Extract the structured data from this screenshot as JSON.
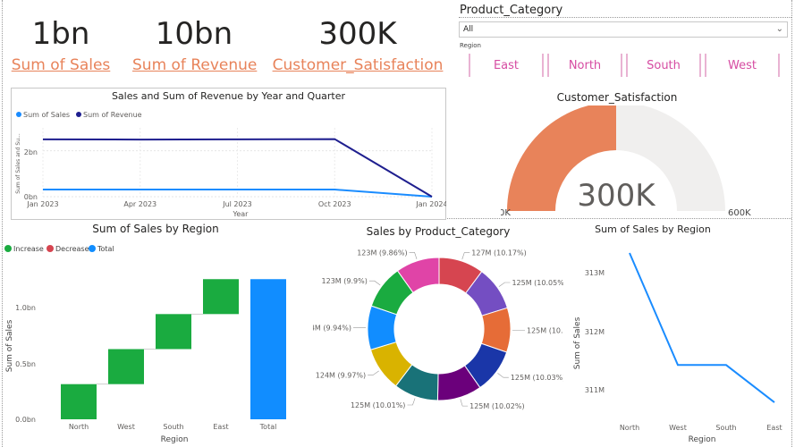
{
  "cards": [
    {
      "value": "1bn",
      "label": "Sum of Sales"
    },
    {
      "value": "10bn",
      "label": "Sum of Revenue"
    },
    {
      "value": "300K",
      "label": "Customer_Satisfaction"
    }
  ],
  "slicers": {
    "category_title": "Product_Category",
    "category_selected": "All",
    "region_title": "Region",
    "regions": [
      "East",
      "North",
      "South",
      "West"
    ]
  },
  "colors": {
    "accent": "#e8835a",
    "pink": "#d64ca2",
    "line_dark": "#1f1f8f",
    "line_light": "#1a8cff",
    "increase": "#1aab40",
    "decrease": "#d64550",
    "total": "#118dff"
  },
  "line_chart": {
    "title": "Sales and Sum of Revenue by Year and Quarter",
    "legend": [
      "Sum of Sales",
      "Sum of Revenue"
    ],
    "ylabel": "Sum of Sales and Su...",
    "xlabel": "Year",
    "yticks": [
      "2bn",
      "0bn"
    ]
  },
  "gauge": {
    "title": "Customer_Satisfaction",
    "value_label": "300K",
    "min_label": "0K",
    "max_label": "600K"
  },
  "waterfall_labels": {
    "title": "Sum of Sales by Region",
    "legend": [
      "Increase",
      "Decrease",
      "Total"
    ],
    "ylabel": "Sum of Sales",
    "xlabel": "Region",
    "yticks": [
      "1.0bn",
      "0.5bn",
      "0.0bn"
    ]
  },
  "donut_labels": {
    "title": "Sales by Product_Category"
  },
  "region_line_labels": {
    "title": "Sum of Sales by Region",
    "ylabel": "Sum of Sales",
    "xlabel": "Region",
    "yticks": [
      "313M",
      "312M",
      "311M"
    ]
  },
  "chart_data": [
    {
      "type": "line",
      "title": "Sales and Sum of Revenue by Year and Quarter",
      "x": [
        "Jan 2023",
        "Apr 2023",
        "Jul 2023",
        "Oct 2023",
        "Jan 2024"
      ],
      "series": [
        {
          "name": "Sum of Sales",
          "values": [
            0.31,
            0.31,
            0.31,
            0.31,
            0.0
          ]
        },
        {
          "name": "Sum of Revenue",
          "values": [
            2.5,
            2.49,
            2.5,
            2.51,
            0.0
          ]
        }
      ],
      "xlabel": "Year",
      "ylabel": "Sum of Sales and Su...",
      "ylim": [
        0,
        3
      ],
      "y_unit": "bn"
    },
    {
      "type": "bar",
      "subtype": "waterfall",
      "title": "Sum of Sales by Region",
      "categories": [
        "North",
        "West",
        "South",
        "East",
        "Total"
      ],
      "values": [
        0.313,
        0.312,
        0.312,
        0.311,
        1.248
      ],
      "kinds": [
        "increase",
        "increase",
        "increase",
        "increase",
        "total"
      ],
      "xlabel": "Region",
      "ylabel": "Sum of Sales",
      "ylim": [
        0,
        1.25
      ],
      "y_unit": "bn"
    },
    {
      "type": "pie",
      "subtype": "donut",
      "title": "Sales by Product_Category",
      "slices": [
        {
          "label": "127M (10.17%)",
          "value": 10.17,
          "color": "#d64550"
        },
        {
          "label": "125M (10.05%)",
          "value": 10.05,
          "color": "#744ec2"
        },
        {
          "label": "125M (10.05%)",
          "value": 10.05,
          "color": "#e66c37"
        },
        {
          "label": "125M (10.03%)",
          "value": 10.03,
          "color": "#1a36a8"
        },
        {
          "label": "125M (10.02%)",
          "value": 10.02,
          "color": "#6b007b"
        },
        {
          "label": "125M (10.01%)",
          "value": 10.01,
          "color": "#197278"
        },
        {
          "label": "124M (9.97%)",
          "value": 9.97,
          "color": "#d9b300"
        },
        {
          "label": "124M (9.94%)",
          "value": 9.94,
          "color": "#118dff"
        },
        {
          "label": "123M (9.9%)",
          "value": 9.9,
          "color": "#1aab40"
        },
        {
          "label": "123M (9.86%)",
          "value": 9.86,
          "color": "#e044a7"
        }
      ]
    },
    {
      "type": "line",
      "title": "Sum of Sales by Region",
      "categories": [
        "North",
        "West",
        "South",
        "East"
      ],
      "values": [
        313.4,
        311.6,
        311.6,
        311.0
      ],
      "xlabel": "Region",
      "ylabel": "Sum of Sales",
      "ylim": [
        310.8,
        313.5
      ],
      "y_unit": "M"
    }
  ]
}
